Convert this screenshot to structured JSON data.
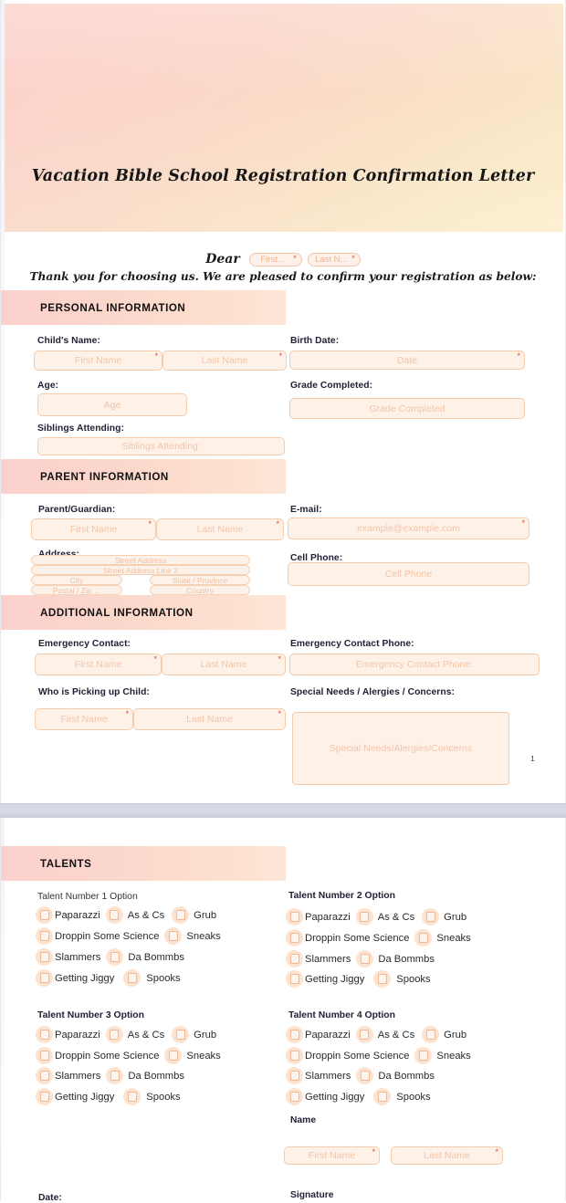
{
  "document": {
    "title": "Vacation Bible School Registration Confirmation Letter",
    "salutation_word": "Dear",
    "salutation_first": "First...",
    "salutation_last": "Last N...",
    "intro_line": "Thank you for choosing us. We are pleased to confirm your registration as below:",
    "page_number": "1",
    "required_mark": "*"
  },
  "colors": {
    "banner_start": "#fbd1cc",
    "banner_end": "#fdeecd",
    "section_bar_start": "#fbd0cd",
    "section_bar_end": "#fde6d6",
    "field_bg": "#fdf1e8",
    "field_border": "#f5cba9",
    "placeholder": "#f3c5a8",
    "required_asterisk": "#e0492c",
    "page_divider": "#d6d8e3",
    "label_text": "#1f2033"
  },
  "sections": {
    "personal": {
      "heading": "PERSONAL INFORMATION",
      "child_name_label": "Child's Name:",
      "child_first_placeholder": "First Name",
      "child_last_placeholder": "Last Name",
      "birth_date_label": "Birth Date:",
      "birth_date_placeholder": "Date",
      "age_label": "Age:",
      "age_placeholder": "Age",
      "grade_label": "Grade Completed:",
      "grade_placeholder": "Grade Completed",
      "siblings_label": "Siblings Attending:",
      "siblings_placeholder": "Siblings Attending:"
    },
    "parent": {
      "heading": "PARENT INFORMATION",
      "guardian_label": "Parent/Guardian:",
      "guardian_first_placeholder": "First Name",
      "guardian_last_placeholder": "Last Name",
      "email_label": "E-mail:",
      "email_placeholder": "example@example.com",
      "address_label": "Address:",
      "address_street": "Street Address",
      "address_street2": "Street Address Line 2",
      "address_city": "City",
      "address_state": "State / Province",
      "address_postal": "Postal / Zip ...",
      "address_country": "Country",
      "cell_label": "Cell Phone:",
      "cell_placeholder": "Cell Phone"
    },
    "additional": {
      "heading": "ADDITIONAL INFORMATION",
      "emergency_label": "Emergency Contact:",
      "emergency_first_placeholder": "First Name",
      "emergency_last_placeholder": "Last Name",
      "emergency_phone_label": "Emergency Contact Phone:",
      "emergency_phone_placeholder": "Emergency Contact Phone:",
      "pickup_label": "Who is Picking up Child:",
      "pickup_first_placeholder": "First Name",
      "pickup_last_placeholder": "Last Name",
      "special_label": "Special Needs / Alergies / Concerns:",
      "special_placeholder": "Special Needs/Alergies/Concerns"
    },
    "talents": {
      "heading": "TALENTS",
      "groups": [
        {
          "title": "Talent Number 1 Option"
        },
        {
          "title": "Talent Number 2 Option"
        },
        {
          "title": "Talent Number 3 Option"
        },
        {
          "title": "Talent Number 4 Option"
        }
      ],
      "options_row1": [
        "Paparazzi",
        "As & Cs",
        "Grub"
      ],
      "options_row2": [
        "Droppin Some Science",
        "Sneaks"
      ],
      "options_row3": [
        "Slammers",
        "Da Bommbs"
      ],
      "options_row4": [
        "Getting Jiggy",
        "Spooks"
      ],
      "name_label": "Name",
      "name_first_placeholder": "First Name",
      "name_last_placeholder": "Last Name",
      "date_label": "Date:",
      "signature_label": "Signature"
    }
  }
}
